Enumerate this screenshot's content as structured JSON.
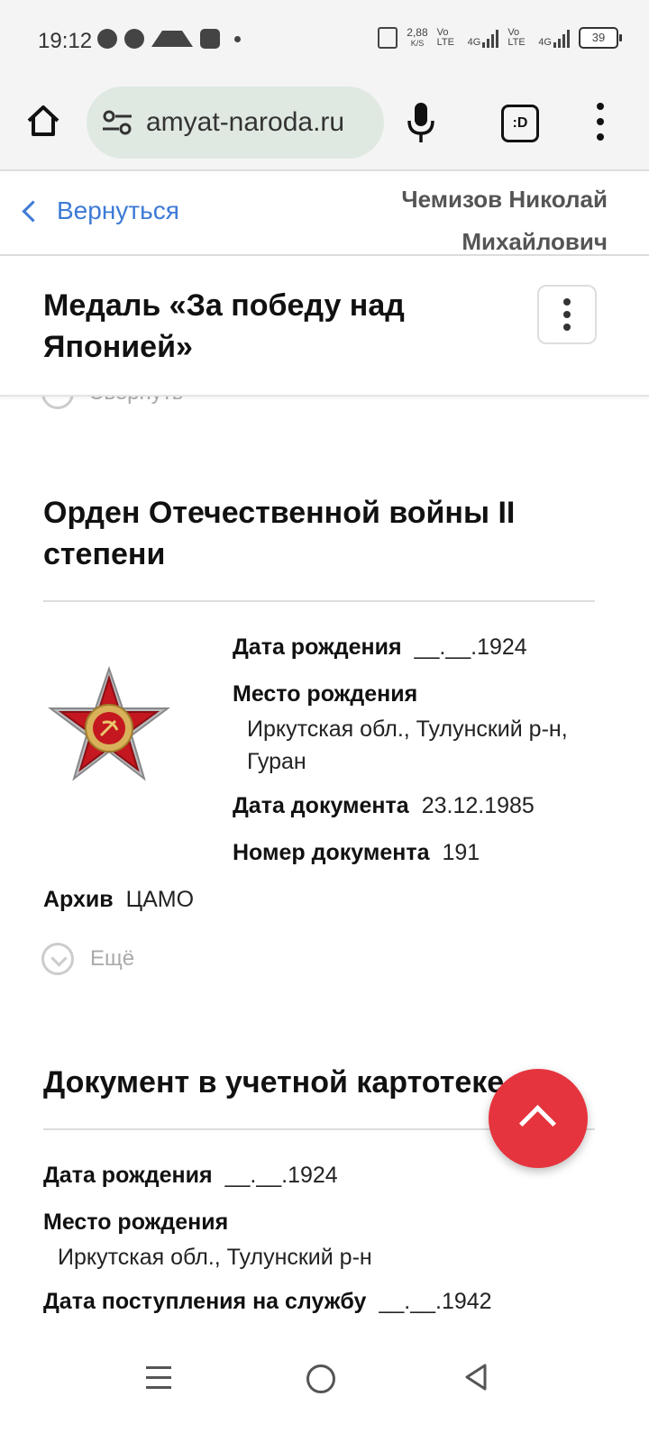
{
  "status_bar": {
    "time": "19:12",
    "net_speed_value": "2,88",
    "net_speed_unit": "K/S",
    "sim1": "Vo LTE",
    "sim1_net": "4G",
    "sim2": "Vo LTE",
    "sim2_net": "4G",
    "battery": "39",
    "notif_icons": [
      "whatsapp-icon",
      "chat-icon",
      "telegram-icon",
      "wb-icon",
      "dot-icon"
    ]
  },
  "browser": {
    "url": "amyat-naroda.ru",
    "tab_label": ":D"
  },
  "page_header": {
    "back_label": "Вернуться",
    "person_line1": "Чемизов Николай",
    "person_line2": "Михайлович"
  },
  "sticky": {
    "title": "Медаль «За победу над Японией»",
    "peek_label": "Свернуть"
  },
  "order_section": {
    "title": "Орден Отечественной войны II степени",
    "fields": {
      "birth_date_label": "Дата рождения",
      "birth_date_value": "__.__.1924",
      "birth_place_label": "Место рождения",
      "birth_place_value": "Иркутская обл., Тулунский р-н, Гуран",
      "doc_date_label": "Дата документа",
      "doc_date_value": "23.12.1985",
      "doc_number_label": "Номер документа",
      "doc_number_value": "191",
      "archive_label": "Архив",
      "archive_value": "ЦАМО"
    },
    "more_label": "Ещё"
  },
  "card_section": {
    "title": "Документ в учетной картотеке",
    "fields": {
      "birth_date_label": "Дата рождения",
      "birth_date_value": "__.__.1924",
      "birth_place_label": "Место рождения",
      "birth_place_value": "Иркутская обл., Тулунский р-н",
      "service_date_label": "Дата поступления на службу",
      "service_date_value": "__.__.1942"
    }
  },
  "colors": {
    "accent_link": "#3d7ad6",
    "fab": "#e5343d",
    "url_pill": "#dfe9e1"
  }
}
